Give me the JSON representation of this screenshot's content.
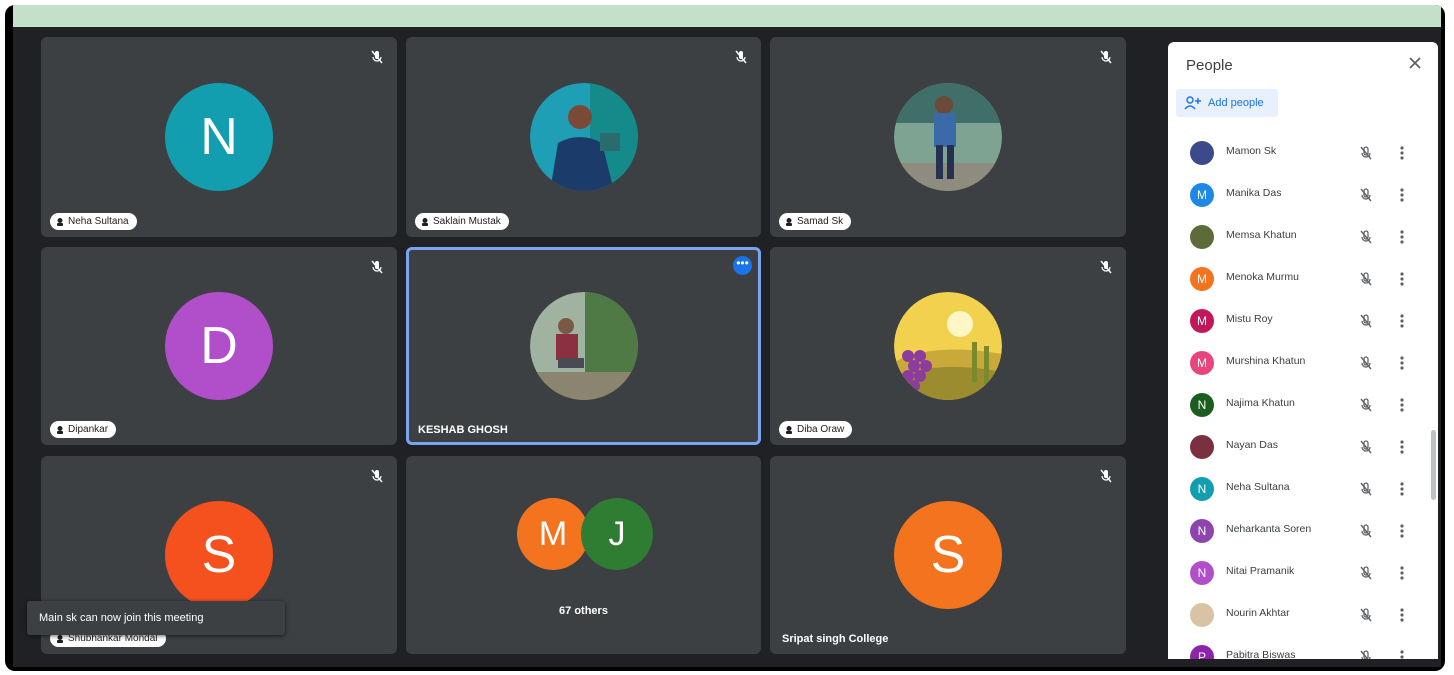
{
  "colors": {
    "stage_bg": "#202124",
    "tile_bg": "#3c4043",
    "accent": "#1a73e8",
    "browser_bar": "#c4e0c9"
  },
  "tiles": [
    {
      "name": "Neha Sultana",
      "initial": "N",
      "avatar_color": "#129eaf",
      "type": "initial"
    },
    {
      "name": "Saklain Mustak",
      "initial": "",
      "avatar_color": "#1f9fb5",
      "type": "photo"
    },
    {
      "name": "Samad Sk",
      "initial": "",
      "avatar_color": "#6a8f7a",
      "type": "photo"
    },
    {
      "name": "Dipankar",
      "initial": "D",
      "avatar_color": "#b04fc9",
      "type": "initial"
    },
    {
      "name": "KESHAB GHOSH",
      "initial": "",
      "avatar_color": "#708f68",
      "type": "photo"
    },
    {
      "name": "Diba Oraw",
      "initial": "",
      "avatar_color": "#e2c04a",
      "type": "illustration"
    },
    {
      "name": "Shubhankar Mondal",
      "initial": "S",
      "avatar_color": "#f4511e",
      "type": "initial"
    },
    {
      "name": "",
      "initial": "",
      "avatar_color": "",
      "type": "others"
    },
    {
      "name": "Sripat singh College",
      "initial": "S",
      "avatar_color": "#f4731e",
      "type": "initial"
    }
  ],
  "others_group": {
    "label": "67 others",
    "avatars": [
      {
        "initial": "M",
        "color": "#f4731e"
      },
      {
        "initial": "J",
        "color": "#2e7d32"
      }
    ]
  },
  "toast": {
    "text": "Main sk can now join this meeting"
  },
  "people_panel": {
    "title": "People",
    "add_label": "Add people",
    "participants": [
      {
        "name": "Mamon Sk",
        "initial": "",
        "color": "#3c4a8a"
      },
      {
        "name": "Manika Das",
        "initial": "M",
        "color": "#1e88e5"
      },
      {
        "name": "Memsa Khatun",
        "initial": "",
        "color": "#5d6b3a"
      },
      {
        "name": "Menoka Murmu",
        "initial": "M",
        "color": "#f4731e"
      },
      {
        "name": "Mistu Roy",
        "initial": "M",
        "color": "#c2185b"
      },
      {
        "name": "Murshina Khatun",
        "initial": "M",
        "color": "#e8457c"
      },
      {
        "name": "Najima Khatun",
        "initial": "N",
        "color": "#1b5e20"
      },
      {
        "name": "Nayan Das",
        "initial": "",
        "color": "#7a3040"
      },
      {
        "name": "Neha Sultana",
        "initial": "N",
        "color": "#129eaf"
      },
      {
        "name": "Neharkanta Soren",
        "initial": "N",
        "color": "#8e44ad"
      },
      {
        "name": "Nitai Pramanik",
        "initial": "N",
        "color": "#b04fc9"
      },
      {
        "name": "Nourin Akhtar",
        "initial": "",
        "color": "#d8c3a5"
      },
      {
        "name": "Pabitra Biswas",
        "initial": "P",
        "color": "#8e24aa"
      }
    ]
  }
}
